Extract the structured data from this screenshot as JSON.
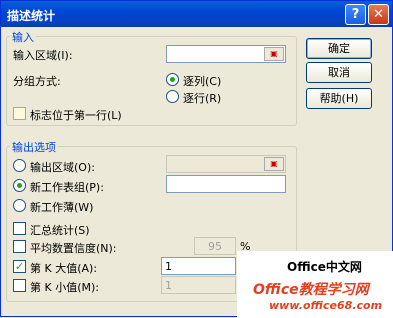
{
  "window": {
    "title": "描述统计",
    "help_glyph": "?",
    "close_glyph": "✕"
  },
  "input_group": {
    "legend": "输入",
    "range_label": "输入区域(I):",
    "range_value": "",
    "group_label": "分组方式:",
    "by_column": "逐列(C)",
    "by_row": "逐行(R)",
    "selected": "by_column",
    "labels_first_row": "标志位于第一行(L)",
    "labels_first_row_checked": false
  },
  "output_group": {
    "legend": "输出选项",
    "output_range": "输出区域(O):",
    "output_range_value": "",
    "new_sheet": "新工作表组(P):",
    "new_sheet_value": "",
    "new_workbook": "新工作薄(W)",
    "selected": "new_sheet",
    "summary_stats": "汇总统计(S)",
    "summary_stats_checked": false,
    "confidence": "平均数置信度(N):",
    "confidence_checked": false,
    "confidence_value": "95",
    "confidence_unit": "%",
    "kth_largest": "第 K 大值(A):",
    "kth_largest_checked": true,
    "kth_largest_value": "1",
    "kth_smallest": "第 K 小值(M):",
    "kth_smallest_checked": false,
    "kth_smallest_value": "1"
  },
  "buttons": {
    "ok": "确定",
    "cancel": "取消",
    "help": "帮助(H)"
  },
  "watermark": {
    "line1": "Office中文网",
    "line2": "Office教程学习网",
    "line3": "www.office68.com"
  },
  "icons": {
    "ref_button": "range-select-icon"
  }
}
